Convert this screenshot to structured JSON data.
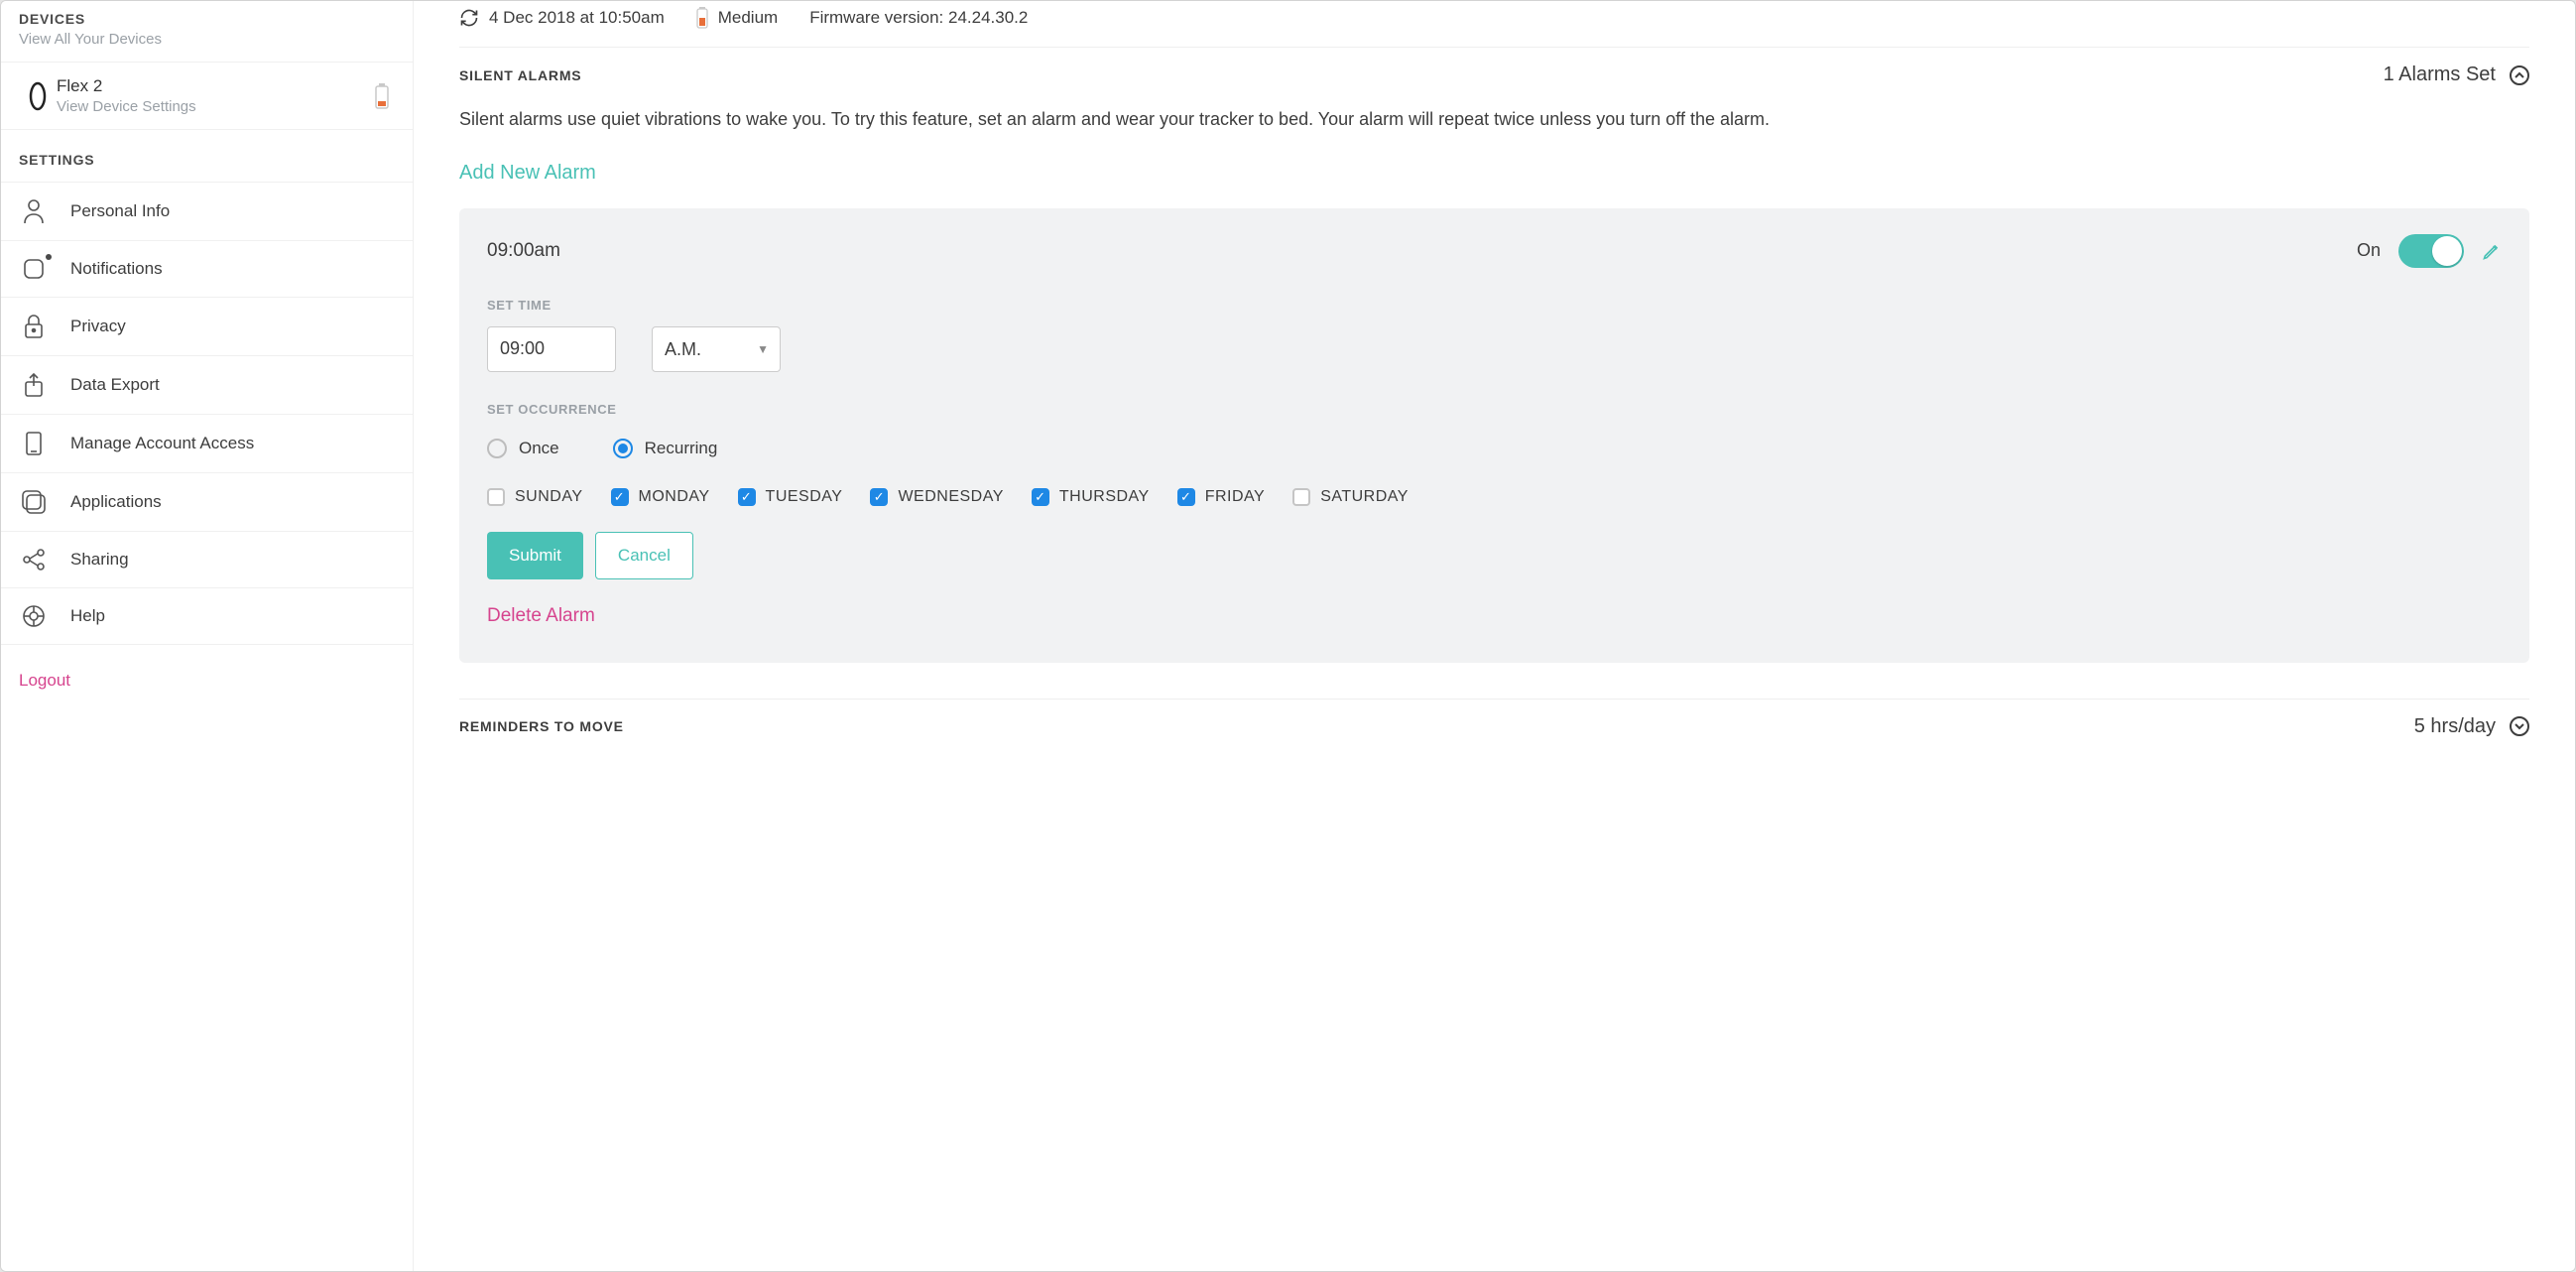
{
  "sidebar": {
    "devices": {
      "title": "DEVICES",
      "subtitle": "View All Your Devices"
    },
    "device": {
      "name": "Flex 2",
      "subtitle": "View Device Settings"
    },
    "settings_title": "SETTINGS",
    "items": [
      {
        "label": "Personal Info"
      },
      {
        "label": "Notifications"
      },
      {
        "label": "Privacy"
      },
      {
        "label": "Data Export"
      },
      {
        "label": "Manage Account Access"
      },
      {
        "label": "Applications"
      },
      {
        "label": "Sharing"
      },
      {
        "label": "Help"
      }
    ],
    "logout": "Logout"
  },
  "sync": {
    "last_sync": "4 Dec 2018 at 10:50am",
    "battery_level": "Medium",
    "firmware_label": "Firmware version: 24.24.30.2"
  },
  "alarms": {
    "section_title": "SILENT ALARMS",
    "count_text": "1 Alarms Set",
    "description": "Silent alarms use quiet vibrations to wake you. To try this feature, set an alarm and wear your tracker to bed. Your alarm will repeat twice unless you turn off the alarm.",
    "add_label": "Add New Alarm",
    "editor": {
      "time_display": "09:00am",
      "state_label": "On",
      "set_time_label": "SET TIME",
      "time_value": "09:00",
      "ampm_value": "A.M.",
      "set_occurrence_label": "SET OCCURRENCE",
      "occurrence": {
        "once": "Once",
        "recurring": "Recurring"
      },
      "days": {
        "sunday": "SUNDAY",
        "monday": "MONDAY",
        "tuesday": "TUESDAY",
        "wednesday": "WEDNESDAY",
        "thursday": "THURSDAY",
        "friday": "FRIDAY",
        "saturday": "SATURDAY"
      },
      "submit_label": "Submit",
      "cancel_label": "Cancel",
      "delete_label": "Delete Alarm"
    }
  },
  "reminders": {
    "title": "REMINDERS TO MOVE",
    "value": "5 hrs/day"
  }
}
